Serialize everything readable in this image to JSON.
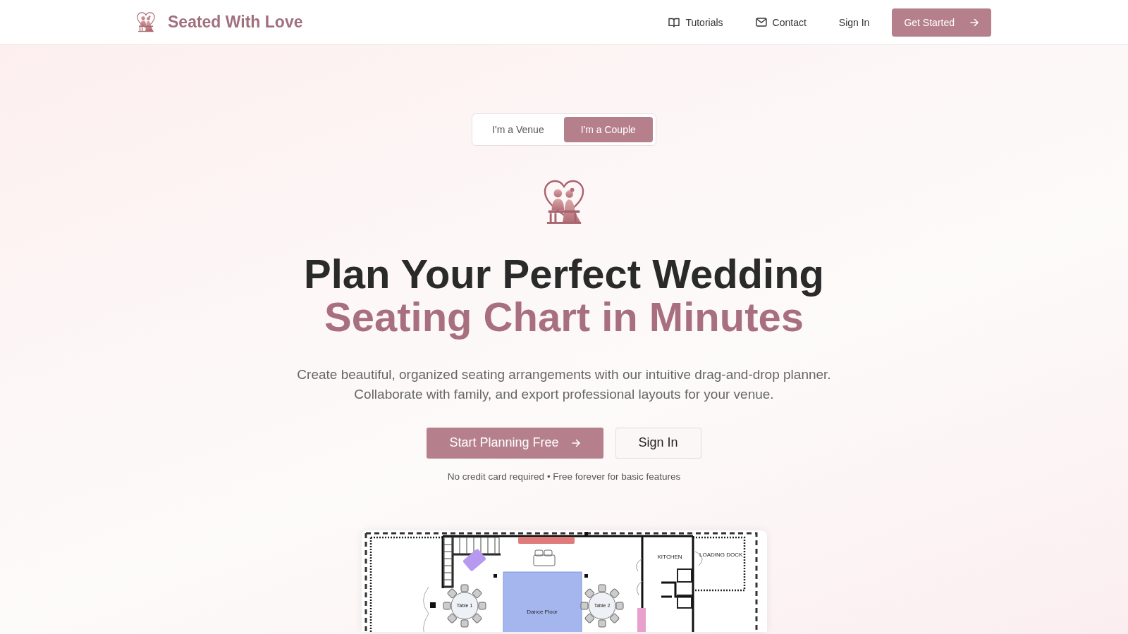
{
  "brand": {
    "name": "Seated With Love"
  },
  "nav": {
    "links": [
      {
        "label": "Tutorials",
        "kind": "book"
      },
      {
        "label": "Contact",
        "kind": "mail"
      },
      {
        "label": "Sign In",
        "kind": "plain"
      }
    ],
    "cta": "Get Started"
  },
  "audience_toggle": [
    {
      "label": "I'm a Venue",
      "selected": false
    },
    {
      "label": "I'm a Couple",
      "selected": true
    }
  ],
  "hero": {
    "title_line_1": "Plan Your Perfect Wedding",
    "title_line_2": "Seating Chart in Minutes",
    "subtitle": "Create beautiful, organized seating arrangements with our intuitive drag-and-drop planner. Collaborate with family, and export professional layouts for your venue.",
    "primary_button": "Start Planning Free",
    "secondary_button": "Sign In",
    "note": "No credit card required • Free forever for basic features"
  },
  "floor_plan": {
    "labels": [
      {
        "text": "Dance Floor",
        "kind": "dance-floor"
      },
      {
        "text": "Table 1",
        "kind": "table"
      },
      {
        "text": "Table 2",
        "kind": "table"
      },
      {
        "text": "KITCHEN",
        "kind": "room"
      },
      {
        "text": "LOADING DOCK",
        "kind": "room"
      }
    ]
  }
}
